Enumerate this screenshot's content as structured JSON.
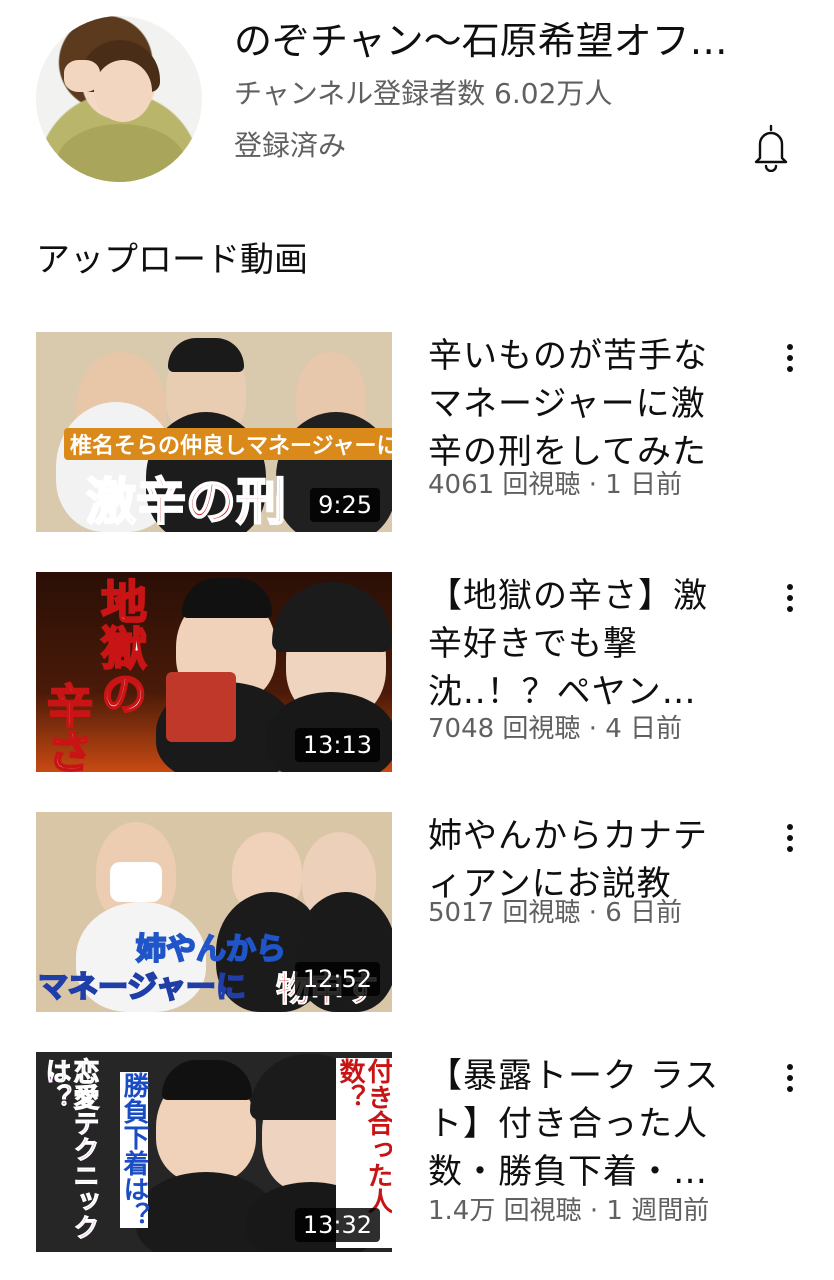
{
  "channel": {
    "name": "のぞチャン〜石原希望オフ…",
    "subscribers": "チャンネル登録者数 6.02万人",
    "subscribed_label": "登録済み"
  },
  "section": {
    "title": "アップロード動画"
  },
  "videos": [
    {
      "title": "辛いものが苦手なマネージャーに激辛の刑をしてみた",
      "meta": "4061 回視聴 · 1 日前",
      "duration": "9:25",
      "thumb_text": [
        "椎名そらの仲良しマネージャーに",
        "激辛の刑"
      ]
    },
    {
      "title": "【地獄の辛さ】激辛好きでも撃沈..！？ペヤング…",
      "meta": "7048 回視聴 · 4 日前",
      "duration": "13:13",
      "thumb_text": [
        "地獄の",
        "辛さ"
      ]
    },
    {
      "title": "姉やんからカナティアンにお説教",
      "meta": "5017 回視聴 · 6 日前",
      "duration": "12:52",
      "thumb_text": [
        "姉やんから",
        "マネージャーに",
        "物申す"
      ]
    },
    {
      "title": "【暴露トーク ラスト】付き合った人数・勝負下着・…",
      "meta": "1.4万 回視聴 · 1 週間前",
      "duration": "13:32",
      "thumb_text": [
        "恋愛テクニックは？",
        "勝負下着は？",
        "付き合った人数？"
      ]
    }
  ],
  "colors": {
    "text": "#0f0f0f",
    "secondary": "#606060",
    "background": "#ffffff"
  },
  "icons": {
    "bell": "bell-icon",
    "more": "more-vert-icon"
  }
}
